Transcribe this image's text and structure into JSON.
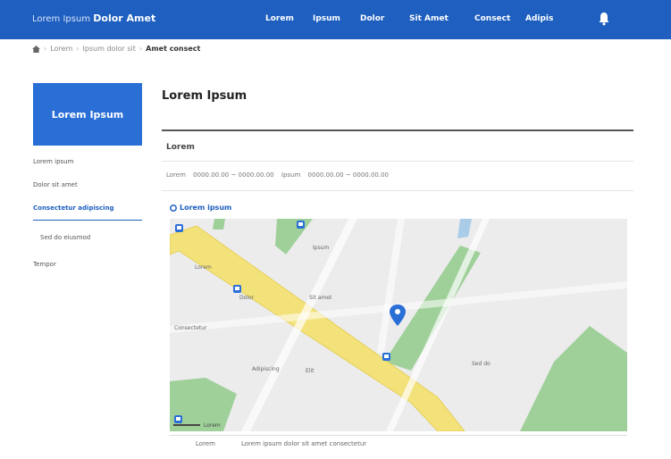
{
  "header": {
    "brand_light": "Lorem Ipsum",
    "brand_bold": "Dolor Amet",
    "nav": [
      "Lorem",
      "Ipsum",
      "Dolor",
      "Sit Amet",
      "Consect",
      "Adipis"
    ]
  },
  "breadcrumb": {
    "items": [
      "Lorem",
      "Ipsum dolor sit"
    ],
    "current": "Amet consect"
  },
  "sidebar": {
    "title": "Lorem Ipsum",
    "items": [
      "Lorem ipsum",
      "Dolor sit amet",
      "Consectetur adipiscing",
      "Sed do eiusmod",
      "Tempor"
    ]
  },
  "main": {
    "title": "Lorem Ipsum",
    "course": "Lorem",
    "period_label": "Lorem",
    "period_value": "0000.00.00 ~ 0000.00.00",
    "edu_label": "Ipsum",
    "edu_value": "0000.00.00 ~ 0000.00.00",
    "location_label": "Lorem ipsum",
    "address_label": "Lorem",
    "address_value": "Lorem ipsum dolor sit amet consectetur"
  },
  "map": {
    "labels": [
      "Lorem",
      "Ipsum",
      "Dolor",
      "Sit amet",
      "Consectetur",
      "Adipiscing",
      "Elit",
      "Sed do"
    ],
    "scale": "Lorem"
  },
  "colors": {
    "brand": "#1e5fbf",
    "road": "#f3e27a",
    "park": "#9fd09a"
  }
}
